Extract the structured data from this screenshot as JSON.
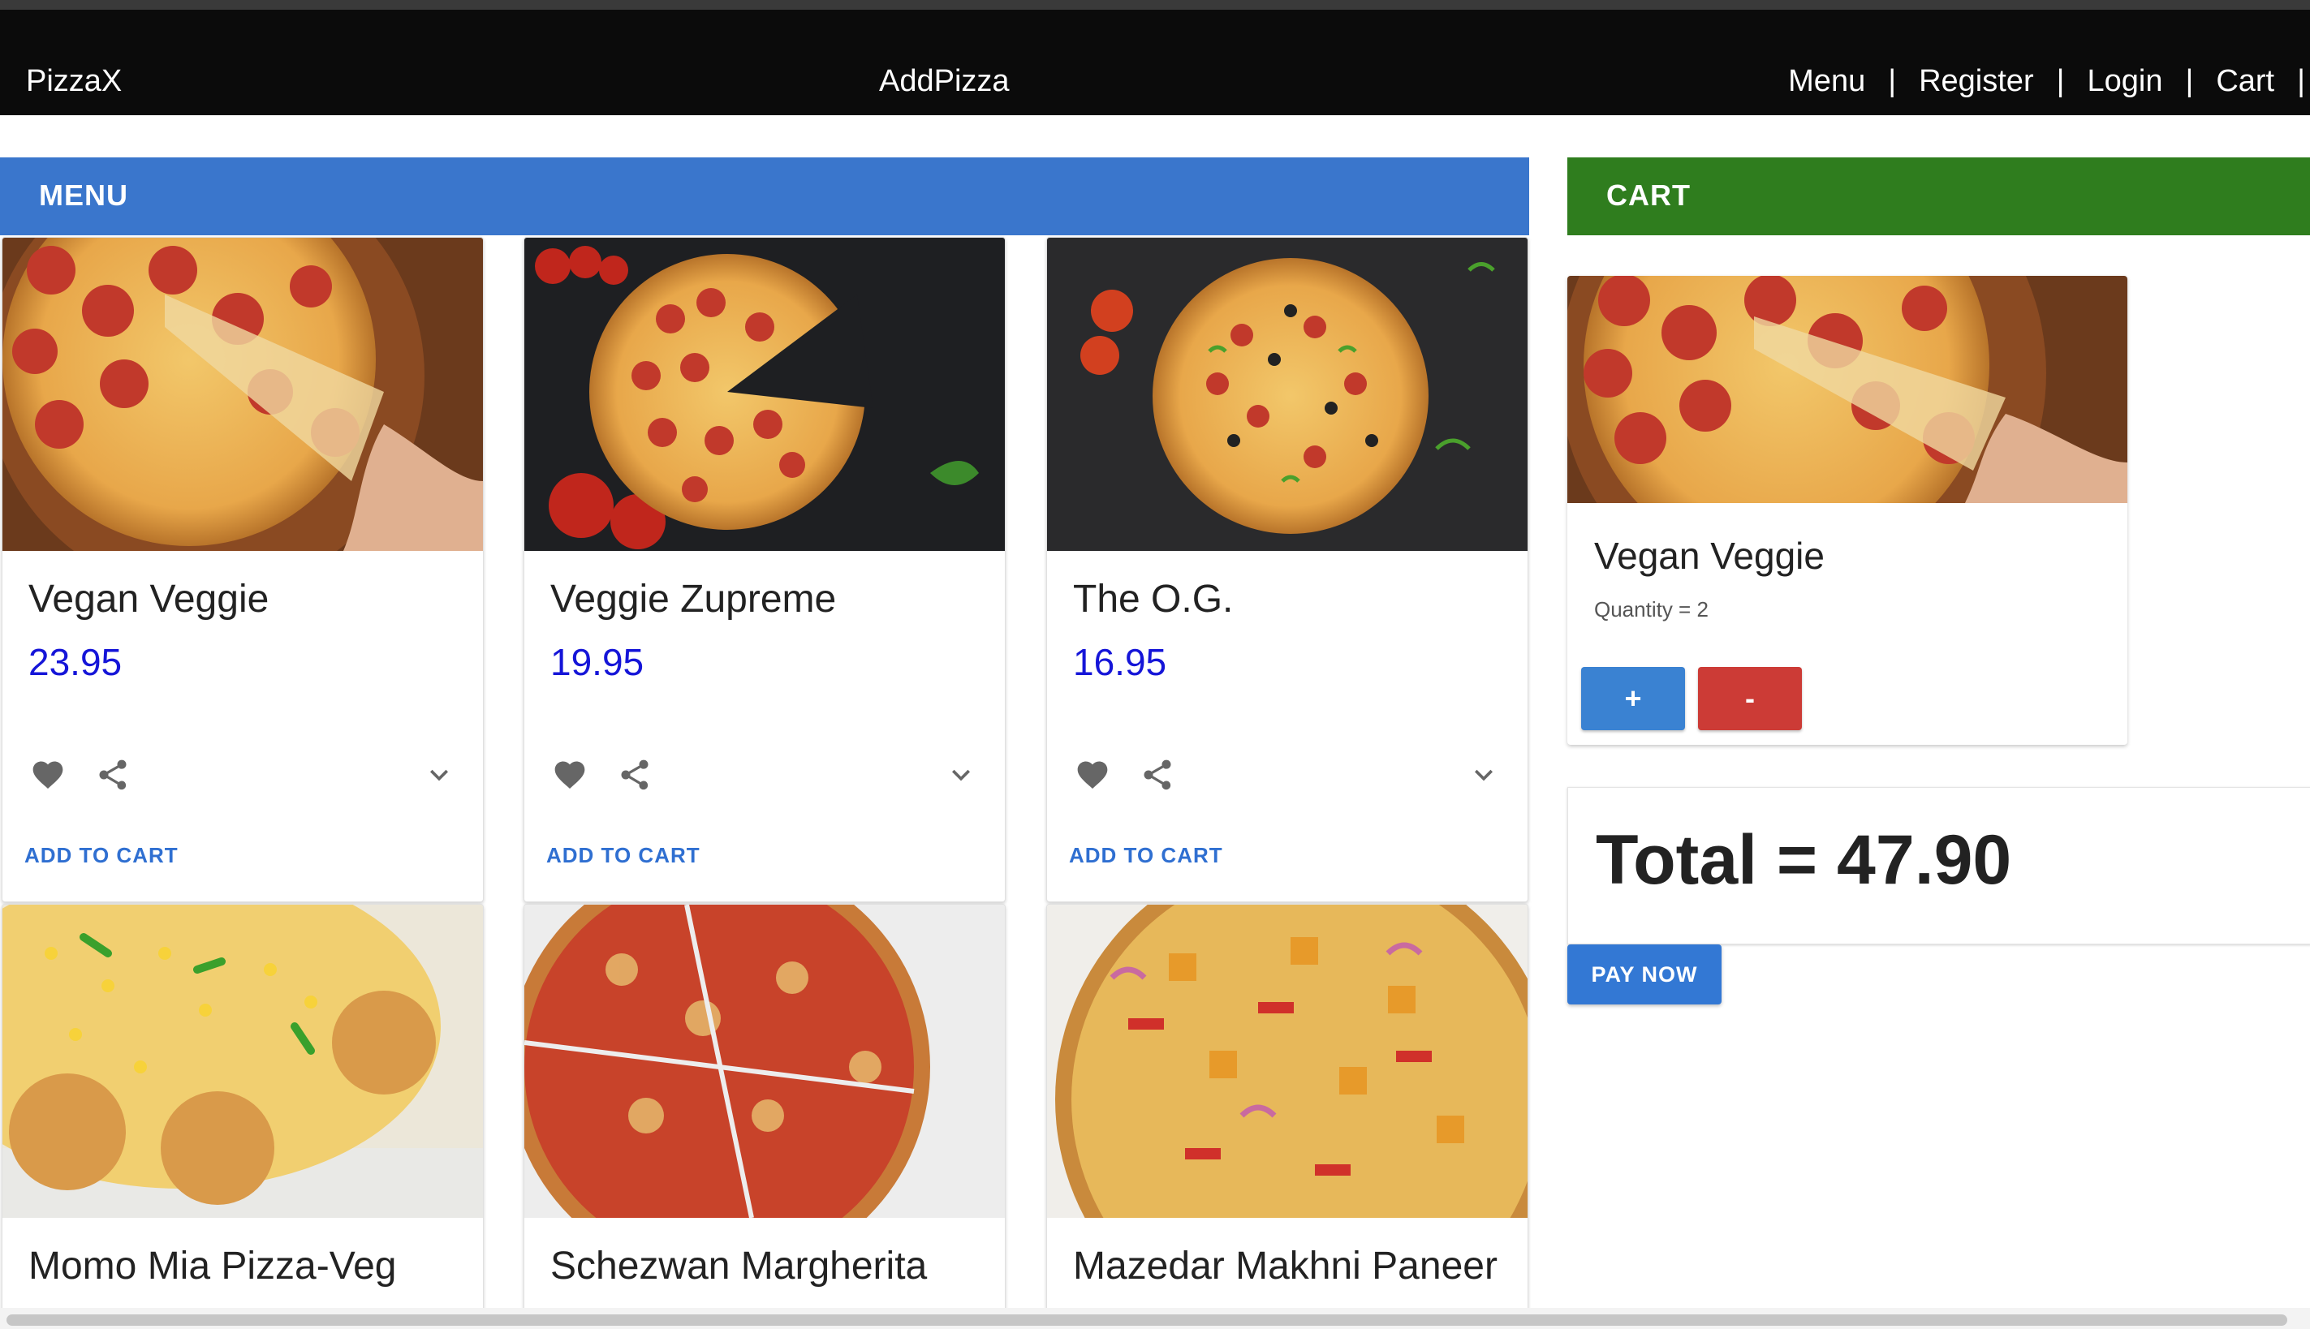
{
  "navbar": {
    "brand": "PizzaX",
    "center_link": "AddPizza",
    "links": [
      "Menu",
      "Register",
      "Login",
      "Cart"
    ],
    "separator": "|"
  },
  "menu": {
    "header": "MENU",
    "items": [
      {
        "name": "Vegan Veggie",
        "price": "23.95",
        "add_label": "ADD TO CART"
      },
      {
        "name": "Veggie Zupreme",
        "price": "19.95",
        "add_label": "ADD TO CART"
      },
      {
        "name": "The O.G.",
        "price": "16.95",
        "add_label": "ADD TO CART"
      },
      {
        "name": "Momo Mia Pizza-Veg"
      },
      {
        "name": "Schezwan Margherita"
      },
      {
        "name": "Mazedar Makhni Paneer"
      }
    ]
  },
  "cart": {
    "header": "CART",
    "item": {
      "name": "Vegan Veggie",
      "quantity_text": "Quantity = 2",
      "plus_label": "+",
      "minus_label": "-"
    },
    "total_text": "Total = 47.90",
    "pay_label": "PAY NOW"
  },
  "icons": {
    "favorite": "heart-icon",
    "share": "share-icon",
    "expand": "chevron-down-icon"
  },
  "colors": {
    "navbar_bg": "#0b0b0b",
    "menu_header": "#3a76cc",
    "cart_header": "#2f7d1e",
    "price": "#1515d8",
    "plus_button": "#3a82d2",
    "minus_button": "#cc3b36",
    "pay_button": "#3378d4"
  }
}
